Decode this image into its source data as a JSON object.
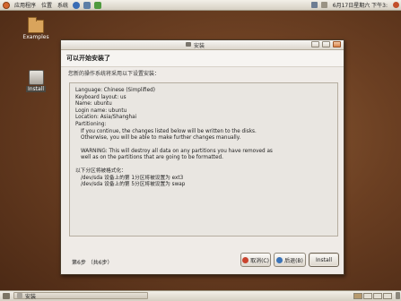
{
  "top_panel": {
    "menus": [
      "应用程序",
      "位置",
      "系统"
    ],
    "clock": "6月17日星期六 下午3:"
  },
  "desktop": {
    "icons": [
      {
        "label": "Examples"
      },
      {
        "label": "Install"
      }
    ]
  },
  "window": {
    "title": "安装",
    "heading": "可以开始安装了",
    "intro": "您新的操作系统将采用以下设置安装：",
    "summary": {
      "lines": [
        "Language: Chinese (Simplified)",
        "Keyboard layout: us",
        "Name: ubuntu",
        "Login name: ubuntu",
        "Location: Asia/Shanghai",
        "Partitioning:",
        "If you continue, the changes listed below will be written to the disks.",
        "Otherwise, you will be able to make further changes manually.",
        "WARNING: This will destroy all data on any partitions you have removed as",
        "well as on the partitions that are going to be formatted.",
        "以下分区将被格式化：",
        "/dev/sda 设备上的第 1分区将被设置为 ext3",
        "/dev/sda 设备上的第 5分区将被设置为 swap"
      ]
    },
    "step": "第6步 （共6步）",
    "buttons": {
      "cancel": "取消(C)",
      "back": "后退(B)",
      "install": "Install"
    }
  },
  "bottom_panel": {
    "task_label": "安装"
  },
  "colors": {
    "desktop_bg": "#6b3f22",
    "panel_bg": "#e3ded3",
    "window_bg": "#efebe7"
  }
}
